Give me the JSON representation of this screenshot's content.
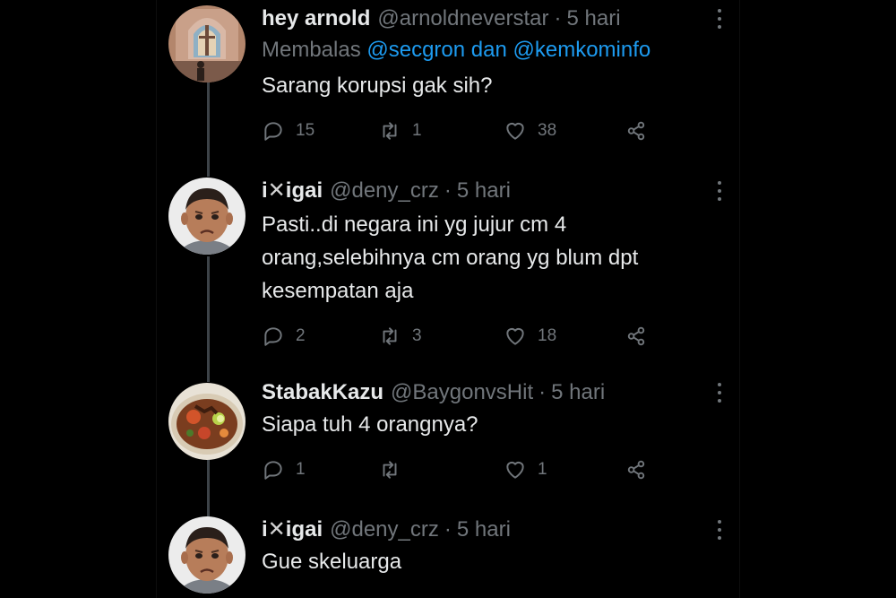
{
  "colors": {
    "background": "#000000",
    "text": "#e7e9ea",
    "muted": "#71767b",
    "link": "#1d9bf0",
    "thread_line": "#3d4348"
  },
  "tweets": [
    {
      "name": "hey arnold",
      "handle": "@arnoldneverstar",
      "time": "5 hari",
      "reply_prefix": "Membalas ",
      "reply_mentions": "@secgron dan @kemkominfo",
      "text": "Sarang korupsi gak sih?",
      "replies": "15",
      "retweets": "1",
      "likes": "38",
      "avatar": "church-interior-avatar"
    },
    {
      "name_prefix": "i",
      "name_mark": "✕",
      "name_suffix": "igai",
      "handle": "@deny_crz",
      "time": "5 hari",
      "text_lines": [
        "Pasti..di negara ini yg jujur cm 4",
        "orang,selebihnya cm orang yg blum dpt",
        "kesempatan aja"
      ],
      "replies": "2",
      "retweets": "3",
      "likes": "18",
      "avatar": "frowning-boy-avatar"
    },
    {
      "name": "StabakKazu",
      "handle": "@BaygonvsHit",
      "time": "5 hari",
      "text": "Siapa tuh 4 orangnya?",
      "replies": "1",
      "retweets": "",
      "likes": "1",
      "avatar": "food-bowl-avatar"
    },
    {
      "name_prefix": "i",
      "name_mark": "✕",
      "name_suffix": "igai",
      "handle": "@deny_crz",
      "time": "5 hari",
      "text": "Gue skeluarga",
      "avatar": "frowning-boy-avatar"
    }
  ],
  "separator": "·"
}
